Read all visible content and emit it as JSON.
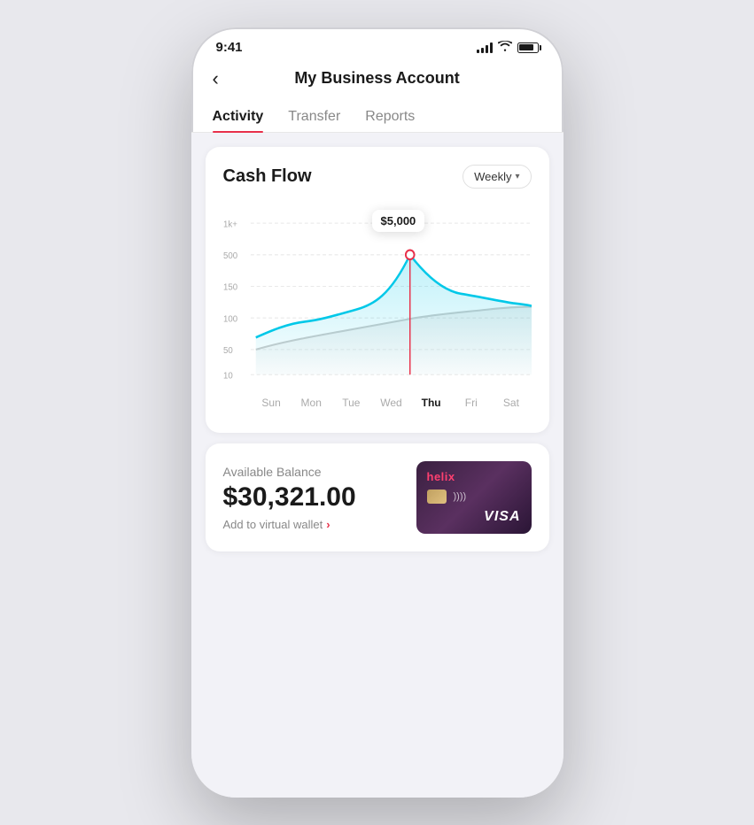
{
  "statusBar": {
    "time": "9:41"
  },
  "header": {
    "title": "My Business Account",
    "backLabel": "‹"
  },
  "tabs": [
    {
      "id": "activity",
      "label": "Activity",
      "active": true
    },
    {
      "id": "transfer",
      "label": "Transfer",
      "active": false
    },
    {
      "id": "reports",
      "label": "Reports",
      "active": false
    }
  ],
  "cashFlow": {
    "title": "Cash Flow",
    "periodLabel": "Weekly",
    "tooltipValue": "$5,000",
    "yLabels": [
      "1k+",
      "500",
      "150",
      "100",
      "50",
      "10"
    ],
    "xLabels": [
      "Sun",
      "Mon",
      "Tue",
      "Wed",
      "Thu",
      "Fri",
      "Sat"
    ]
  },
  "balance": {
    "label": "Available Balance",
    "amount": "$30,321.00",
    "addWalletText": "Add to virtual wallet"
  },
  "card": {
    "brand": "helix",
    "visaLabel": "VISA"
  }
}
